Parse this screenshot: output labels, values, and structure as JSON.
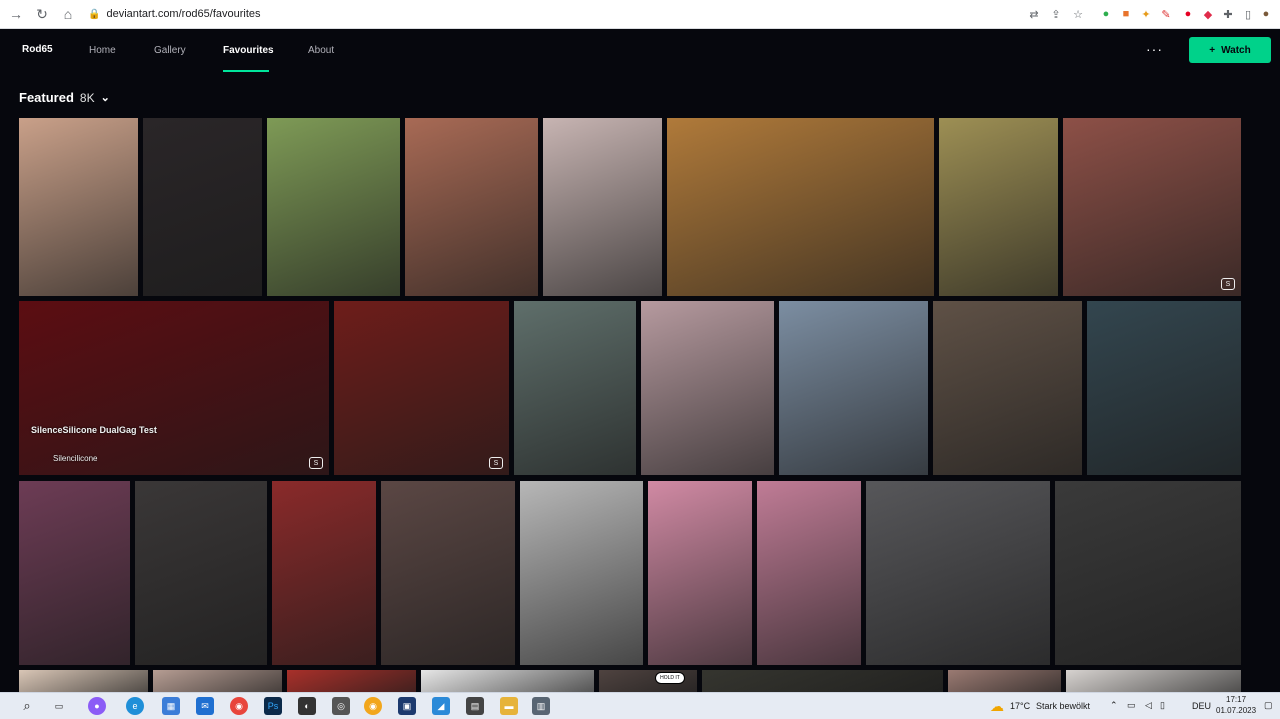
{
  "browser": {
    "url": "deviantart.com/rod65/favourites",
    "back_icon": "back-arrow-icon",
    "reload_icon": "reload-icon",
    "home_icon": "home-icon",
    "lock_icon": "lock-icon"
  },
  "nav": {
    "username": "Rod65",
    "tabs": [
      {
        "label": "Home"
      },
      {
        "label": "Gallery"
      },
      {
        "label": "Favourites"
      },
      {
        "label": "About"
      }
    ],
    "more": "···",
    "watch_plus": "+",
    "watch_label": "Watch",
    "accent": "#00e59b"
  },
  "featured": {
    "title": "Featured",
    "count": "8K"
  },
  "tiles": [
    {
      "caption": "",
      "color": "#c9a089"
    },
    {
      "caption": "",
      "color": "#2a2628"
    },
    {
      "caption": "",
      "color": "#7e9a56"
    },
    {
      "caption": "",
      "color": "#a86a55"
    },
    {
      "caption": "",
      "color": "#c7b4b2"
    },
    {
      "caption": "",
      "color": "#b07a3a"
    },
    {
      "caption": "",
      "color": "#9d8f54"
    },
    {
      "caption": "",
      "color": "#8d5047"
    },
    {
      "caption": "SilenceSilicone DualGag Test",
      "author": "Silencilicone",
      "color": "#5c0d12"
    },
    {
      "caption": "",
      "color": "#6e1d1a"
    },
    {
      "caption": "",
      "color": "#5f6f6b"
    },
    {
      "caption": "",
      "color": "#b69a9f"
    },
    {
      "caption": "",
      "color": "#7c8ea2"
    },
    {
      "caption": "",
      "color": "#5f5146"
    },
    {
      "caption": "",
      "color": "#33464f"
    },
    {
      "caption": "",
      "color": "#6d3c55"
    },
    {
      "caption": "",
      "color": "#3a3737"
    },
    {
      "caption": "",
      "color": "#8a2a2a"
    },
    {
      "caption": "",
      "color": "#5b4744"
    },
    {
      "caption": "",
      "color": "#b7b7b7"
    },
    {
      "caption": "",
      "color": "#d18aa4"
    },
    {
      "caption": "",
      "color": "#c07c96"
    },
    {
      "caption": "",
      "color": "#57575a"
    },
    {
      "caption": "",
      "color": "#3a3a3a"
    },
    {
      "caption": "",
      "color": "#d9c6b6"
    },
    {
      "caption": "",
      "color": "#b69d93"
    },
    {
      "caption": "",
      "color": "#a8302a"
    },
    {
      "caption": "",
      "color": "#e6e6e6"
    },
    {
      "caption": "HOLD IT",
      "color": "#4f4340"
    },
    {
      "caption": "",
      "color": "#35352f"
    },
    {
      "caption": "",
      "color": "#9a7a72"
    },
    {
      "caption": "",
      "color": "#d6d2cf"
    }
  ],
  "taskbar": {
    "weather_temp": "17°C",
    "weather_text": "Stark bewölkt",
    "language": "DEU",
    "time": "17:17",
    "date": "01.07.2023"
  }
}
